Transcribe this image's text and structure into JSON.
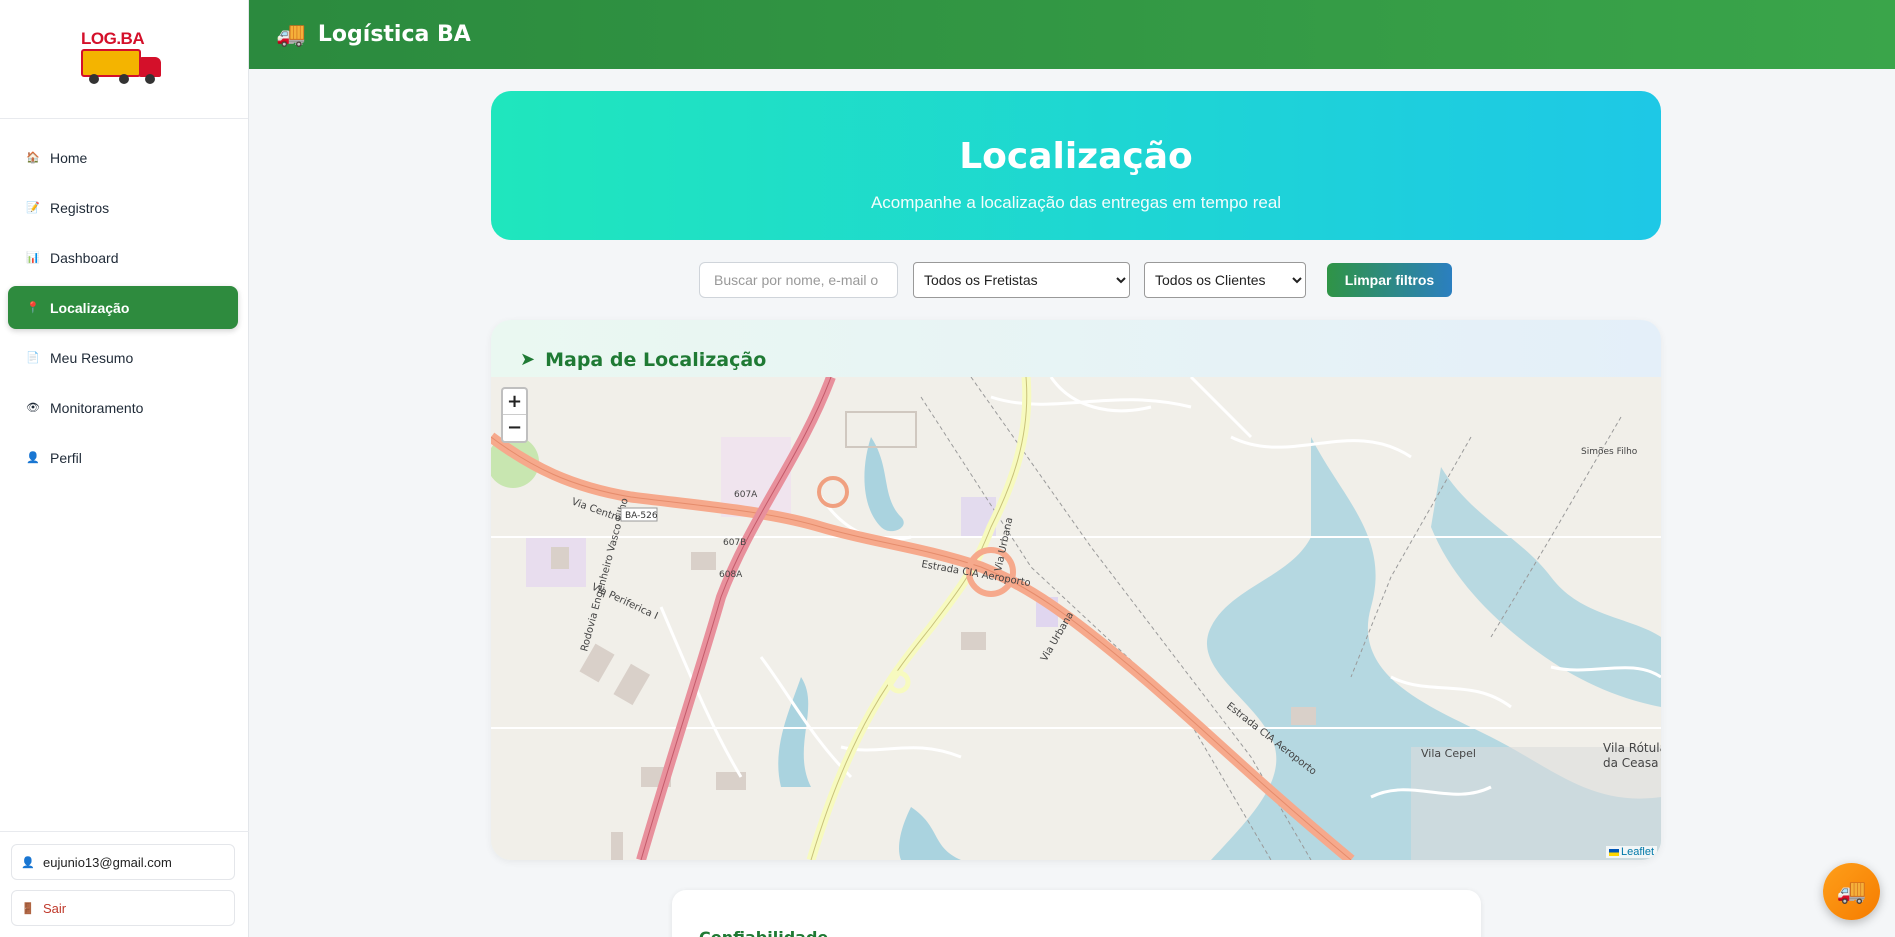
{
  "brand": {
    "logo_text": "LOG.BA"
  },
  "sidebar": {
    "items": [
      {
        "label": "Home",
        "icon": "house-icon",
        "glyph": "🏠",
        "active": false
      },
      {
        "label": "Registros",
        "icon": "clipboard-icon",
        "glyph": "📝",
        "active": false
      },
      {
        "label": "Dashboard",
        "icon": "chart-icon",
        "glyph": "📊",
        "active": false
      },
      {
        "label": "Localização",
        "icon": "pin-icon",
        "glyph": "📍",
        "active": true
      },
      {
        "label": "Meu Resumo",
        "icon": "document-icon",
        "glyph": "📄",
        "active": false
      },
      {
        "label": "Monitoramento",
        "icon": "eye-icon",
        "glyph": "👁",
        "active": false
      },
      {
        "label": "Perfil",
        "icon": "user-icon",
        "glyph": "👤",
        "active": false
      }
    ],
    "user_email": "eujunio13@gmail.com",
    "logout_label": "Sair"
  },
  "header": {
    "title": "Logística BA",
    "icon": "truck-icon"
  },
  "hero": {
    "title": "Localização",
    "subtitle": "Acompanhe a localização das entregas em tempo real"
  },
  "filters": {
    "search_placeholder": "Buscar por nome, e-mail o",
    "fretistas_selected": "Todos os Fretistas",
    "clientes_selected": "Todos os Clientes",
    "clear_label": "Limpar filtros"
  },
  "map": {
    "title": "Mapa de Localização",
    "zoom_in": "+",
    "zoom_out": "−",
    "attribution": "Leaflet",
    "labels": {
      "road1": "Estrada CIA Aeroporto",
      "road2": "Estrada CIA Aeroporto",
      "road3": "Via Urbana",
      "road4": "Via Urbana",
      "road5": "BA-526",
      "road6": "Via Centro",
      "road7": "Rodovia Engenheiro Vasco Filho",
      "place1": "Vila Cepel",
      "place2": "Vila Rótula",
      "place2b": "da Ceasa",
      "place3": "Simões Filho",
      "road8": "Via Periferica I",
      "road9": "607A",
      "road10": "607B",
      "road11": "608A"
    }
  },
  "lower_card": {
    "title": "Confiabilidade"
  },
  "colors": {
    "primary": "#2e8b3e",
    "accent": "#1ec8e6",
    "fab": "#f57c00"
  }
}
